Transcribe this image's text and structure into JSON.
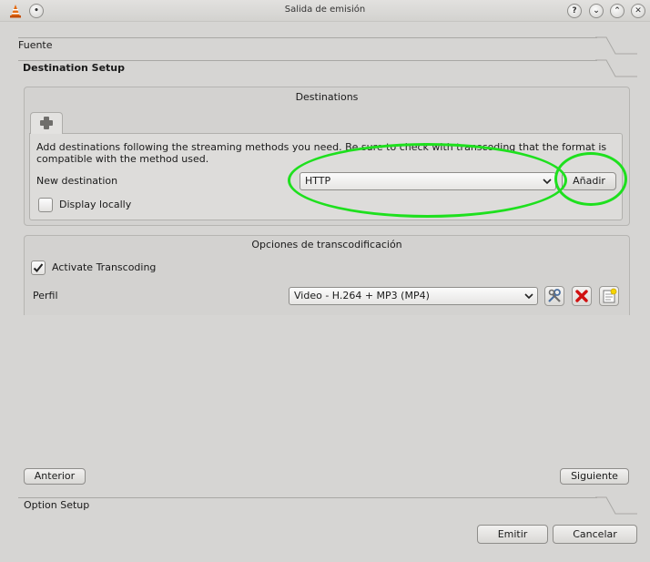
{
  "window": {
    "title": "Salida de emisión",
    "controls": [
      "help-icon",
      "minimize-icon",
      "maximize-icon",
      "close-icon"
    ],
    "control_glyphs": {
      "help": "?",
      "minimize": "⌄",
      "maximize": "⌃",
      "close": "✕"
    }
  },
  "sections": {
    "source": "Fuente",
    "destination_setup": "Destination Setup",
    "option_setup": "Option Setup"
  },
  "destinations": {
    "group_title": "Destinations",
    "add_tab_icon": "plus-icon",
    "description": "Add destinations following the streaming methods you need. Be sure to check with transcoding that the format is compatible with the method used.",
    "new_destination_label": "New destination",
    "new_destination_value": "HTTP",
    "add_button": "Añadir",
    "display_locally_label": "Display locally",
    "display_locally_checked": false
  },
  "transcoding": {
    "group_title": "Opciones de transcodificación",
    "activate_label": "Activate Transcoding",
    "activate_checked": true,
    "profile_label": "Perfil",
    "profile_value": "Video - H.264 + MP3 (MP4)",
    "profile_icons": [
      "wrench-icon",
      "delete-icon",
      "new-profile-icon"
    ]
  },
  "nav": {
    "previous": "Anterior",
    "next": "Siguiente"
  },
  "footer": {
    "emit": "Emitir",
    "cancel": "Cancelar"
  },
  "colors": {
    "highlight_ellipse": "#1ee01e",
    "delete_red": "#d01010"
  }
}
